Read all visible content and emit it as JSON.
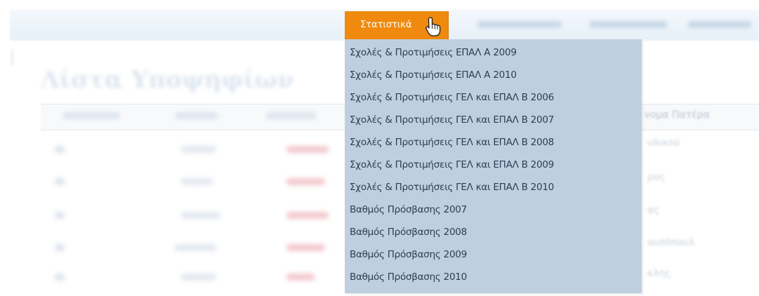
{
  "menu": {
    "active_label": "Στατιστικά",
    "cursor_icon": "hand-pointer-icon",
    "items": [
      {
        "label": "Σχολές & Προτιμήσεις ΕΠΑΛ Α 2009"
      },
      {
        "label": "Σχολές & Προτιμήσεις ΕΠΑΛ Α 2010"
      },
      {
        "label": "Σχολές & Προτιμήσεις ΓΕΛ και ΕΠΑΛ Β 2006"
      },
      {
        "label": "Σχολές & Προτιμήσεις ΓΕΛ και ΕΠΑΛ Β 2007"
      },
      {
        "label": "Σχολές & Προτιμήσεις ΓΕΛ και ΕΠΑΛ Β 2008"
      },
      {
        "label": "Σχολές & Προτιμήσεις ΓΕΛ και ΕΠΑΛ Β 2009"
      },
      {
        "label": "Σχολές & Προτιμήσεις ΓΕΛ και ΕΠΑΛ Β 2010"
      },
      {
        "label": "Βαθμός Πρόσβασης 2007"
      },
      {
        "label": "Βαθμός Πρόσβασης 2008"
      },
      {
        "label": "Βαθμός Πρόσβασης 2009"
      },
      {
        "label": "Βαθμός Πρόσβασης 2010"
      }
    ]
  },
  "colors": {
    "menu_tab": "#ef8a0e",
    "dropdown_bg": "#c0cfe0",
    "dropdown_text": "#2c3d54",
    "accent_red": "#e8556a"
  }
}
